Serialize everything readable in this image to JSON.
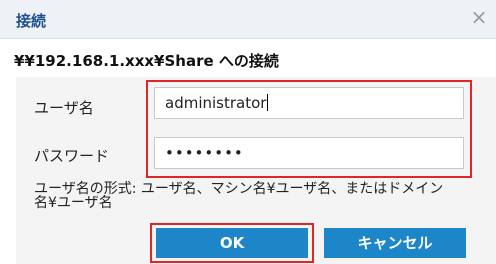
{
  "dialog": {
    "title": "接続",
    "close_glyph": "×",
    "share_title": "¥¥192.168.1.xxx¥Share への接続"
  },
  "form": {
    "username_label": "ユーザ名",
    "username_value": "administrator",
    "password_label": "パスワード",
    "password_masked": "••••••••",
    "hint": "ユーザ名の形式: ユーザ名、マシン名¥ユーザ名、またはドメイン名¥ユーザ名"
  },
  "buttons": {
    "ok_label": "OK",
    "cancel_label": "キャンセル"
  },
  "colors": {
    "title_text": "#1f4f8f",
    "titlebar_bg": "#eef2f7",
    "panel_bg": "#f4f4f4",
    "button_bg": "#1c86c8",
    "highlight_border": "#e02727"
  },
  "icons": {
    "close": "close-icon"
  }
}
